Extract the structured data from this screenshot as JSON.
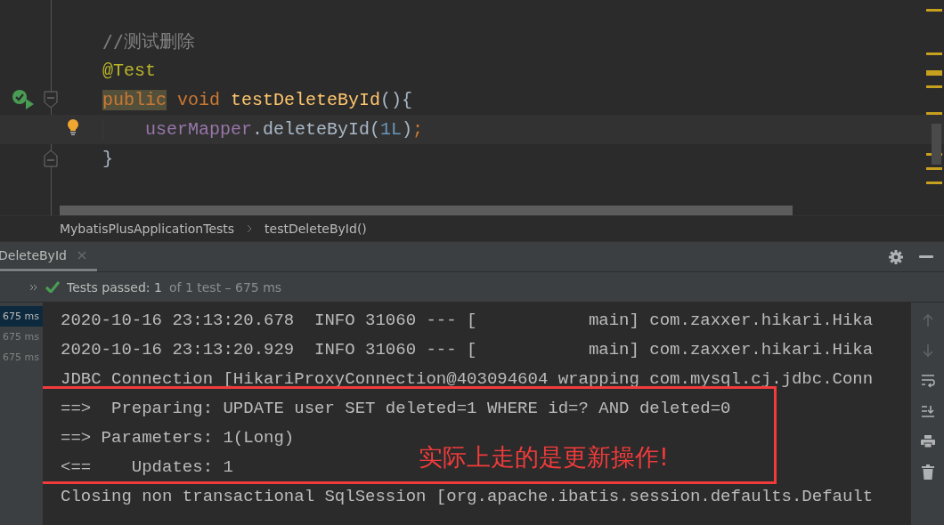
{
  "editor": {
    "lines": [
      {
        "current": false,
        "indented": false,
        "tokens": [
          {
            "kind": "comment",
            "text": "//测试删除"
          }
        ]
      },
      {
        "current": false,
        "indented": false,
        "tokens": [
          {
            "kind": "annotation",
            "text": "@Test"
          }
        ]
      },
      {
        "current": false,
        "indented": false,
        "tokens": [
          {
            "kind": "keyword_usage",
            "text": "public"
          },
          {
            "kind": "keyword",
            "text": " void "
          },
          {
            "kind": "method",
            "text": "testDeleteById"
          },
          {
            "kind": "plain",
            "text": "(){"
          }
        ]
      },
      {
        "current": true,
        "indented": true,
        "tokens": [
          {
            "kind": "field",
            "text": "userMapper"
          },
          {
            "kind": "plain",
            "text": ".deleteById("
          },
          {
            "kind": "number",
            "text": "1L"
          },
          {
            "kind": "plain",
            "text": ")"
          },
          {
            "kind": "keyword",
            "text": ";"
          }
        ]
      },
      {
        "current": false,
        "indented": false,
        "tokens": [
          {
            "kind": "plain",
            "text": "}"
          }
        ]
      }
    ]
  },
  "breadcrumbs": [
    "MybatisPlusApplicationTests",
    "testDeleteById()"
  ],
  "tabs": [
    {
      "label": "DeleteById",
      "selected": true
    }
  ],
  "status": {
    "passed": "Tests passed: 1",
    "detail": "of 1 test – 675 ms"
  },
  "durations": [
    {
      "text": "675 ms",
      "selected": true
    },
    {
      "text": "675 ms",
      "selected": false
    },
    {
      "text": "675 ms",
      "selected": false
    }
  ],
  "console": {
    "lines": [
      "2020-10-16 23:13:20.678  INFO 31060 --- [           main] com.zaxxer.hikari.Hika",
      "2020-10-16 23:13:20.929  INFO 31060 --- [           main] com.zaxxer.hikari.Hika",
      "JDBC Connection [HikariProxyConnection@403094604 wrapping com.mysql.cj.jdbc.Conn",
      "==>  Preparing: UPDATE user SET deleted=1 WHERE id=? AND deleted=0",
      "==> Parameters: 1(Long)",
      "<==    Updates: 1",
      "Closing non transactional SqlSession [org.apache.ibatis.session.defaults.Default"
    ],
    "annotation": "实际上走的是更新操作!"
  }
}
